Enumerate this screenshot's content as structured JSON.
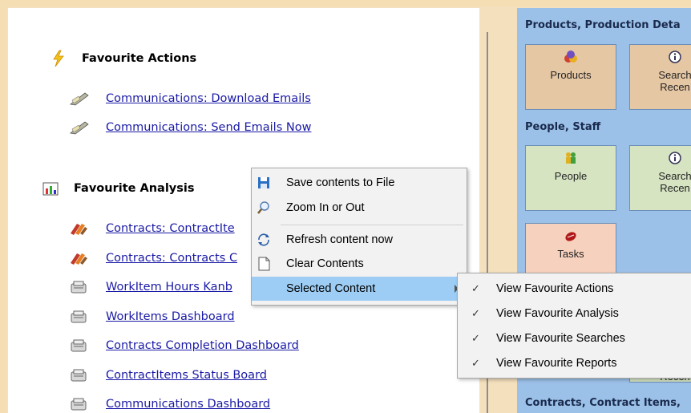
{
  "favourite_actions": {
    "title": "Favourite Actions",
    "links": [
      "Communications: Download Emails",
      "Communications: Send Emails Now"
    ]
  },
  "favourite_analysis": {
    "title": "Favourite Analysis",
    "links": [
      "Contracts: ContractIte",
      "Contracts: Contracts C",
      "WorkItem Hours Kanb",
      "WorkItems Dashboard",
      "Contracts Completion Dashboard",
      "ContractItems Status Board",
      "Communications Dashboard"
    ]
  },
  "tiles_panel": {
    "groups": [
      {
        "title": "Products, Production Deta"
      },
      {
        "title": "People, Staff"
      },
      {
        "title": "Contracts, Contract Items,"
      }
    ],
    "tiles": [
      {
        "label": "Products",
        "label2": ""
      },
      {
        "label": "Search",
        "label2": "Recen"
      },
      {
        "label": "People",
        "label2": ""
      },
      {
        "label": "Search",
        "label2": "Recen"
      },
      {
        "label": "Tasks",
        "label2": ""
      },
      {
        "label": "",
        "label2": "Recen"
      }
    ]
  },
  "context_menu": {
    "items": [
      {
        "label": "Save contents to File",
        "icon": "save-icon"
      },
      {
        "label": "Zoom In or Out",
        "icon": "magnifier-icon"
      },
      {
        "label": "Refresh content now",
        "icon": "refresh-icon"
      },
      {
        "label": "Clear Contents",
        "icon": "document-icon"
      },
      {
        "label": "Selected Content",
        "icon": ""
      }
    ]
  },
  "submenu": {
    "items": [
      {
        "label": "View Favourite Actions",
        "checked": "✓"
      },
      {
        "label": "View Favourite Analysis",
        "checked": "✓"
      },
      {
        "label": "View Favourite Searches",
        "checked": "✓"
      },
      {
        "label": "View Favourite Reports",
        "checked": "✓"
      }
    ]
  }
}
